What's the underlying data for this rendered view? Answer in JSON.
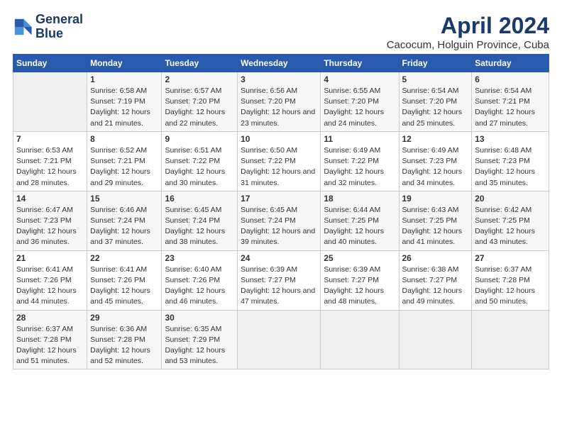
{
  "header": {
    "logo_line1": "General",
    "logo_line2": "Blue",
    "month_year": "April 2024",
    "location": "Cacocum, Holguin Province, Cuba"
  },
  "weekdays": [
    "Sunday",
    "Monday",
    "Tuesday",
    "Wednesday",
    "Thursday",
    "Friday",
    "Saturday"
  ],
  "weeks": [
    [
      {
        "day": "",
        "sunrise": "",
        "sunset": "",
        "daylight": "",
        "empty": true
      },
      {
        "day": "1",
        "sunrise": "Sunrise: 6:58 AM",
        "sunset": "Sunset: 7:19 PM",
        "daylight": "Daylight: 12 hours and 21 minutes."
      },
      {
        "day": "2",
        "sunrise": "Sunrise: 6:57 AM",
        "sunset": "Sunset: 7:20 PM",
        "daylight": "Daylight: 12 hours and 22 minutes."
      },
      {
        "day": "3",
        "sunrise": "Sunrise: 6:56 AM",
        "sunset": "Sunset: 7:20 PM",
        "daylight": "Daylight: 12 hours and 23 minutes."
      },
      {
        "day": "4",
        "sunrise": "Sunrise: 6:55 AM",
        "sunset": "Sunset: 7:20 PM",
        "daylight": "Daylight: 12 hours and 24 minutes."
      },
      {
        "day": "5",
        "sunrise": "Sunrise: 6:54 AM",
        "sunset": "Sunset: 7:20 PM",
        "daylight": "Daylight: 12 hours and 25 minutes."
      },
      {
        "day": "6",
        "sunrise": "Sunrise: 6:54 AM",
        "sunset": "Sunset: 7:21 PM",
        "daylight": "Daylight: 12 hours and 27 minutes."
      }
    ],
    [
      {
        "day": "7",
        "sunrise": "Sunrise: 6:53 AM",
        "sunset": "Sunset: 7:21 PM",
        "daylight": "Daylight: 12 hours and 28 minutes."
      },
      {
        "day": "8",
        "sunrise": "Sunrise: 6:52 AM",
        "sunset": "Sunset: 7:21 PM",
        "daylight": "Daylight: 12 hours and 29 minutes."
      },
      {
        "day": "9",
        "sunrise": "Sunrise: 6:51 AM",
        "sunset": "Sunset: 7:22 PM",
        "daylight": "Daylight: 12 hours and 30 minutes."
      },
      {
        "day": "10",
        "sunrise": "Sunrise: 6:50 AM",
        "sunset": "Sunset: 7:22 PM",
        "daylight": "Daylight: 12 hours and 31 minutes."
      },
      {
        "day": "11",
        "sunrise": "Sunrise: 6:49 AM",
        "sunset": "Sunset: 7:22 PM",
        "daylight": "Daylight: 12 hours and 32 minutes."
      },
      {
        "day": "12",
        "sunrise": "Sunrise: 6:49 AM",
        "sunset": "Sunset: 7:23 PM",
        "daylight": "Daylight: 12 hours and 34 minutes."
      },
      {
        "day": "13",
        "sunrise": "Sunrise: 6:48 AM",
        "sunset": "Sunset: 7:23 PM",
        "daylight": "Daylight: 12 hours and 35 minutes."
      }
    ],
    [
      {
        "day": "14",
        "sunrise": "Sunrise: 6:47 AM",
        "sunset": "Sunset: 7:23 PM",
        "daylight": "Daylight: 12 hours and 36 minutes."
      },
      {
        "day": "15",
        "sunrise": "Sunrise: 6:46 AM",
        "sunset": "Sunset: 7:24 PM",
        "daylight": "Daylight: 12 hours and 37 minutes."
      },
      {
        "day": "16",
        "sunrise": "Sunrise: 6:45 AM",
        "sunset": "Sunset: 7:24 PM",
        "daylight": "Daylight: 12 hours and 38 minutes."
      },
      {
        "day": "17",
        "sunrise": "Sunrise: 6:45 AM",
        "sunset": "Sunset: 7:24 PM",
        "daylight": "Daylight: 12 hours and 39 minutes."
      },
      {
        "day": "18",
        "sunrise": "Sunrise: 6:44 AM",
        "sunset": "Sunset: 7:25 PM",
        "daylight": "Daylight: 12 hours and 40 minutes."
      },
      {
        "day": "19",
        "sunrise": "Sunrise: 6:43 AM",
        "sunset": "Sunset: 7:25 PM",
        "daylight": "Daylight: 12 hours and 41 minutes."
      },
      {
        "day": "20",
        "sunrise": "Sunrise: 6:42 AM",
        "sunset": "Sunset: 7:25 PM",
        "daylight": "Daylight: 12 hours and 43 minutes."
      }
    ],
    [
      {
        "day": "21",
        "sunrise": "Sunrise: 6:41 AM",
        "sunset": "Sunset: 7:26 PM",
        "daylight": "Daylight: 12 hours and 44 minutes."
      },
      {
        "day": "22",
        "sunrise": "Sunrise: 6:41 AM",
        "sunset": "Sunset: 7:26 PM",
        "daylight": "Daylight: 12 hours and 45 minutes."
      },
      {
        "day": "23",
        "sunrise": "Sunrise: 6:40 AM",
        "sunset": "Sunset: 7:26 PM",
        "daylight": "Daylight: 12 hours and 46 minutes."
      },
      {
        "day": "24",
        "sunrise": "Sunrise: 6:39 AM",
        "sunset": "Sunset: 7:27 PM",
        "daylight": "Daylight: 12 hours and 47 minutes."
      },
      {
        "day": "25",
        "sunrise": "Sunrise: 6:39 AM",
        "sunset": "Sunset: 7:27 PM",
        "daylight": "Daylight: 12 hours and 48 minutes."
      },
      {
        "day": "26",
        "sunrise": "Sunrise: 6:38 AM",
        "sunset": "Sunset: 7:27 PM",
        "daylight": "Daylight: 12 hours and 49 minutes."
      },
      {
        "day": "27",
        "sunrise": "Sunrise: 6:37 AM",
        "sunset": "Sunset: 7:28 PM",
        "daylight": "Daylight: 12 hours and 50 minutes."
      }
    ],
    [
      {
        "day": "28",
        "sunrise": "Sunrise: 6:37 AM",
        "sunset": "Sunset: 7:28 PM",
        "daylight": "Daylight: 12 hours and 51 minutes."
      },
      {
        "day": "29",
        "sunrise": "Sunrise: 6:36 AM",
        "sunset": "Sunset: 7:28 PM",
        "daylight": "Daylight: 12 hours and 52 minutes."
      },
      {
        "day": "30",
        "sunrise": "Sunrise: 6:35 AM",
        "sunset": "Sunset: 7:29 PM",
        "daylight": "Daylight: 12 hours and 53 minutes."
      },
      {
        "day": "",
        "sunrise": "",
        "sunset": "",
        "daylight": "",
        "empty": true
      },
      {
        "day": "",
        "sunrise": "",
        "sunset": "",
        "daylight": "",
        "empty": true
      },
      {
        "day": "",
        "sunrise": "",
        "sunset": "",
        "daylight": "",
        "empty": true
      },
      {
        "day": "",
        "sunrise": "",
        "sunset": "",
        "daylight": "",
        "empty": true
      }
    ]
  ]
}
